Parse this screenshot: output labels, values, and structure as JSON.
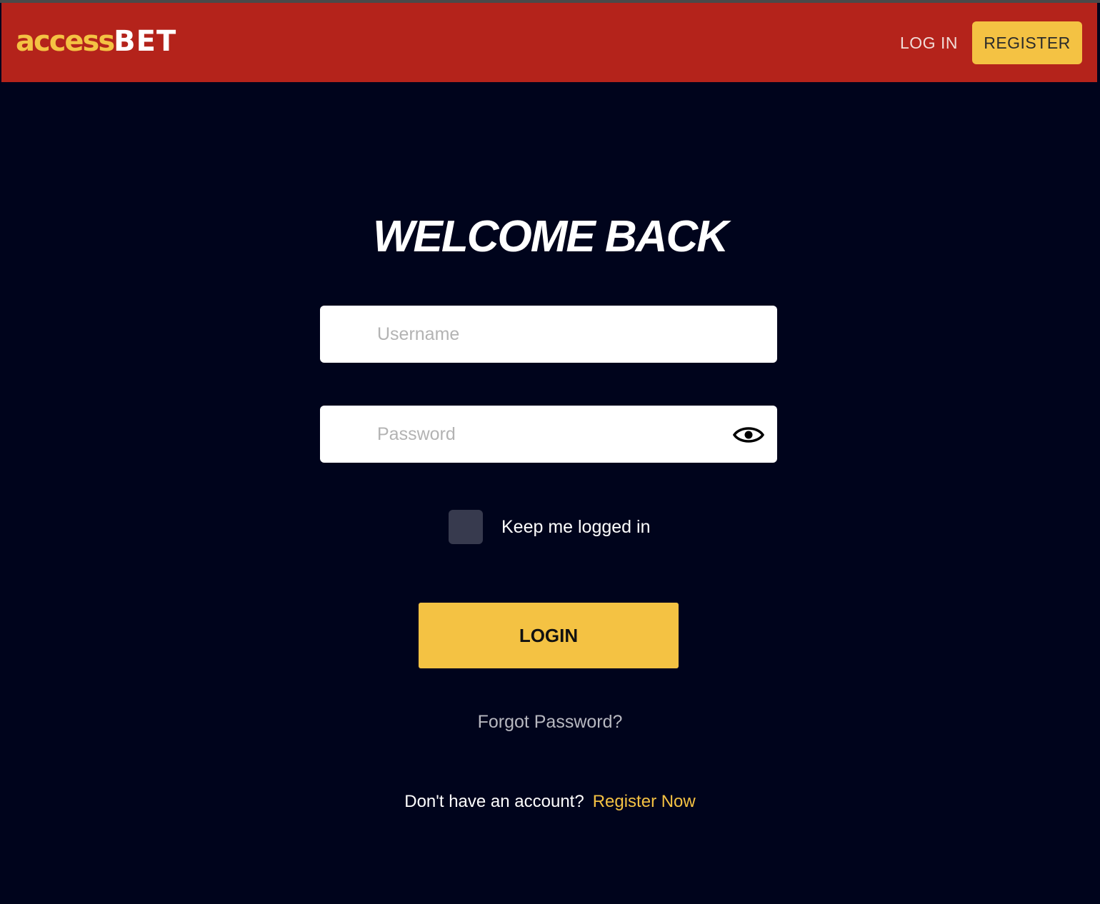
{
  "brand": {
    "logo_part1": "access",
    "logo_part2": "BET"
  },
  "header": {
    "login_label": "LOG IN",
    "register_label": "REGISTER"
  },
  "form": {
    "title": "WELCOME BACK",
    "username_placeholder": "Username",
    "username_value": "",
    "password_placeholder": "Password",
    "password_value": "",
    "password_toggle_icon": "eye-icon",
    "keep_logged_in_label": "Keep me logged in",
    "keep_logged_in_checked": false,
    "login_button_label": "LOGIN",
    "forgot_password_label": "Forgot Password?",
    "no_account_text": "Don't have an account?",
    "register_now_label": "Register Now"
  },
  "colors": {
    "header_bg": "#b4231b",
    "page_bg": "#00041c",
    "accent": "#f4c243"
  }
}
